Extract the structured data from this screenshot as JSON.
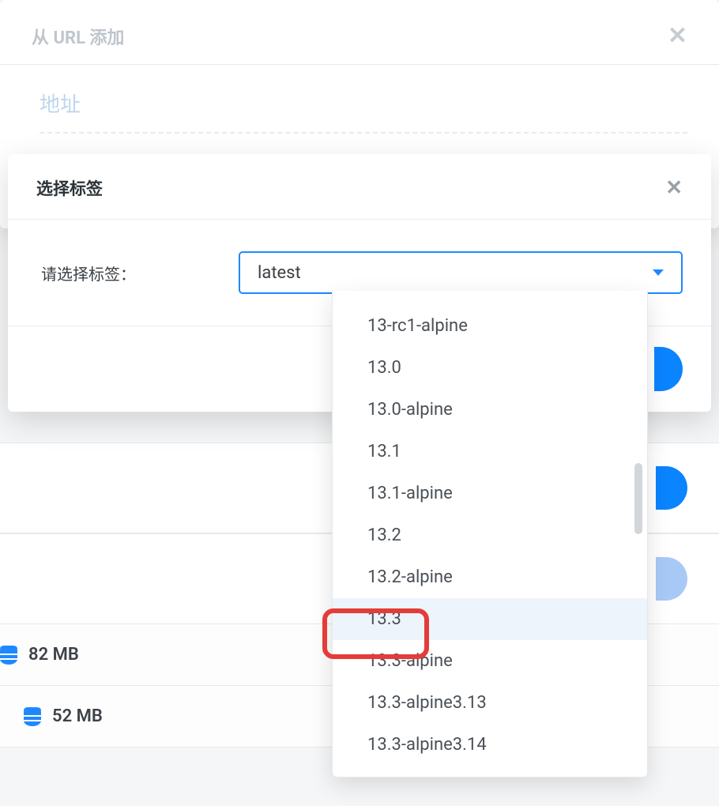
{
  "bg_modal": {
    "title": "从 URL 添加",
    "url_label": "地址"
  },
  "fg_modal": {
    "title": "选择标签",
    "label": "请选择标签：",
    "selected": "latest",
    "options": [
      "13-rc1-alpine",
      "13.0",
      "13.0-alpine",
      "13.1",
      "13.1-alpine",
      "13.2",
      "13.2-alpine",
      "13.3",
      "13.3-alpine",
      "13.3-alpine3.13",
      "13.3-alpine3.14"
    ],
    "highlighted_index": 7
  },
  "bg_list": {
    "sizes": [
      "82 MB",
      "52 MB"
    ]
  }
}
